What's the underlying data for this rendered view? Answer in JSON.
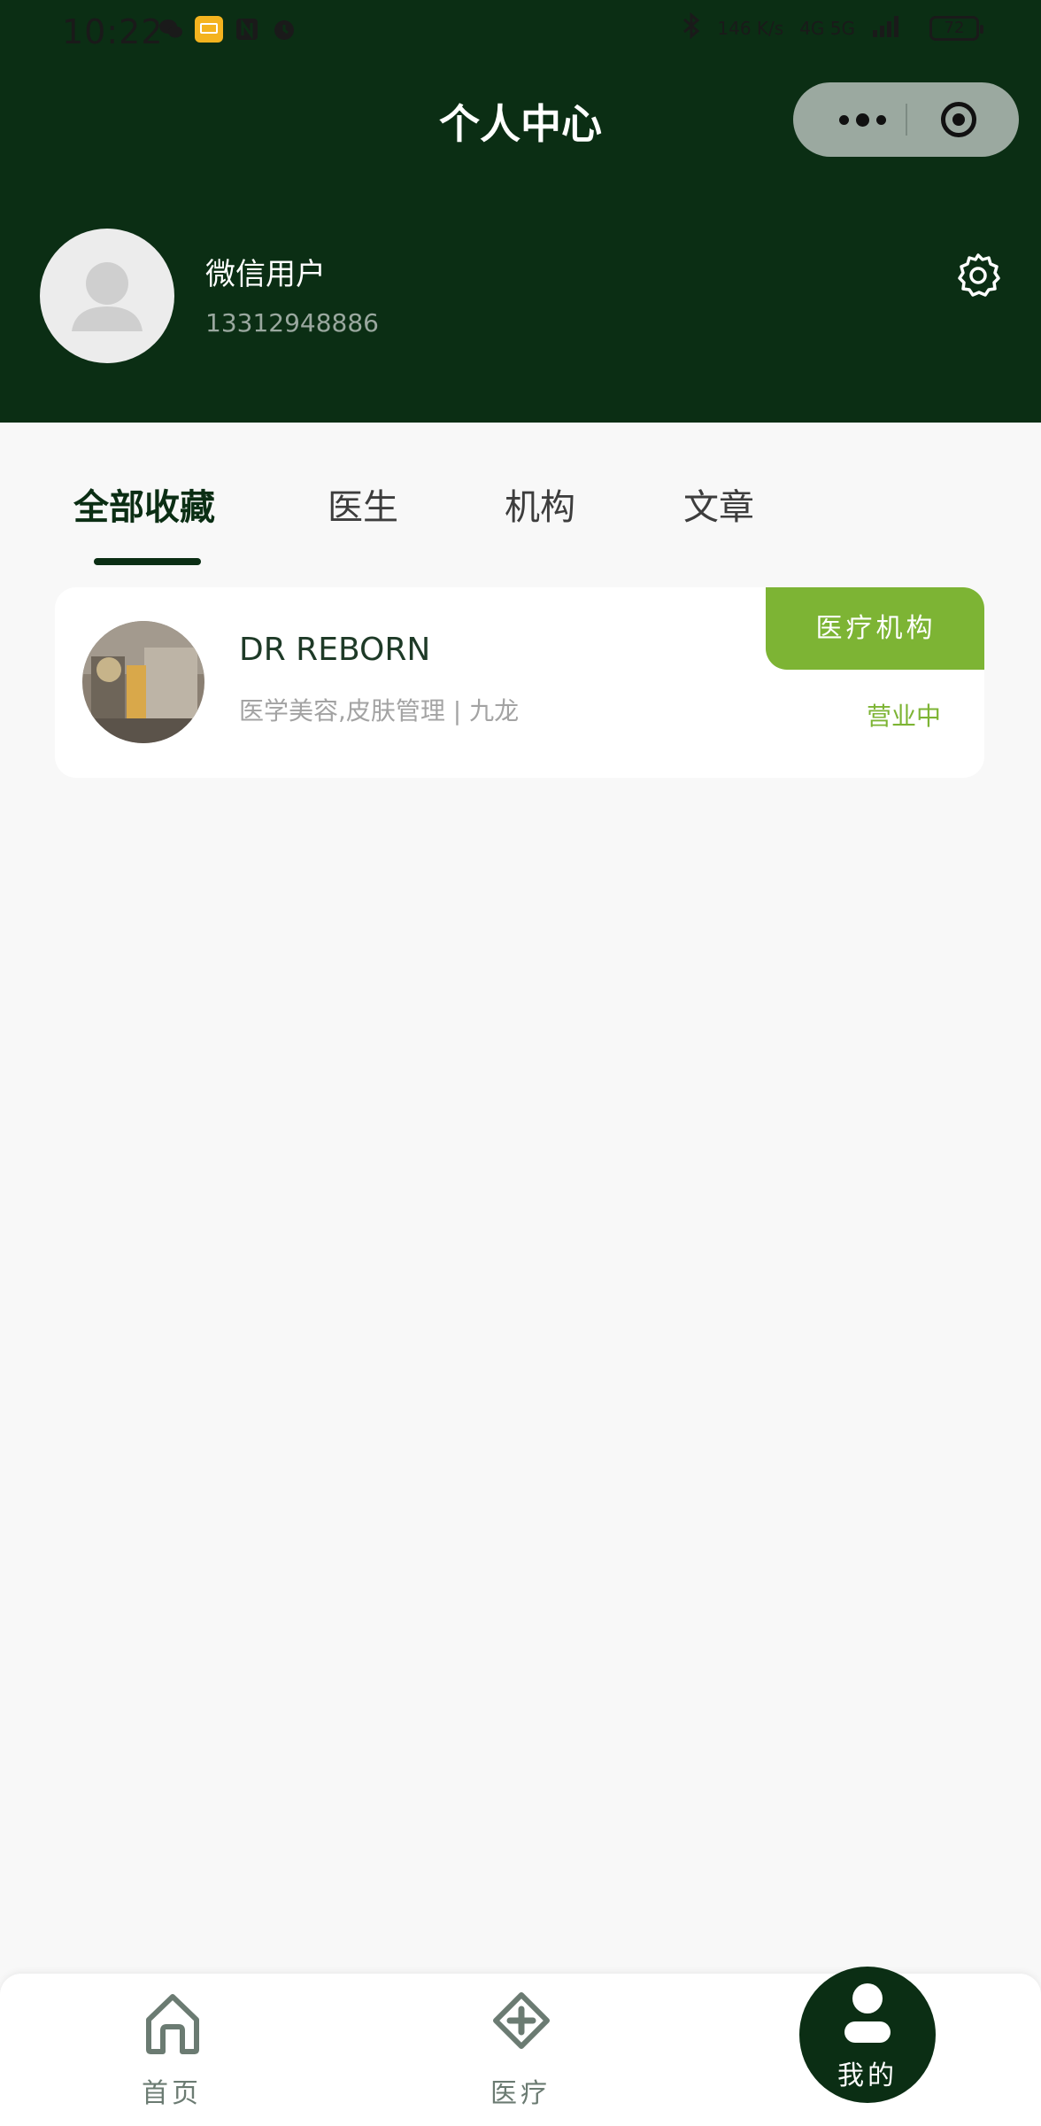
{
  "status_bar": {
    "time": "10:22",
    "speed": "146 K/s",
    "network": "4G 5G",
    "battery": "72"
  },
  "header": {
    "title": "个人中心"
  },
  "profile": {
    "name": "微信用户",
    "phone": "13312948886"
  },
  "tabs": [
    {
      "label": "全部收藏",
      "active": true
    },
    {
      "label": "医生",
      "active": false
    },
    {
      "label": "机构",
      "active": false
    },
    {
      "label": "文章",
      "active": false
    }
  ],
  "favorites": [
    {
      "title": "DR REBORN",
      "subtitle": "医学美容,皮肤管理 | 九龙",
      "badge": "医疗机构",
      "status": "营业中"
    }
  ],
  "bottom_nav": {
    "home": "首页",
    "medical": "医疗",
    "me": "我的"
  },
  "colors": {
    "primary_dark_green": "#0b2e14",
    "accent_green": "#7db434",
    "background": "#f8f8f8"
  }
}
